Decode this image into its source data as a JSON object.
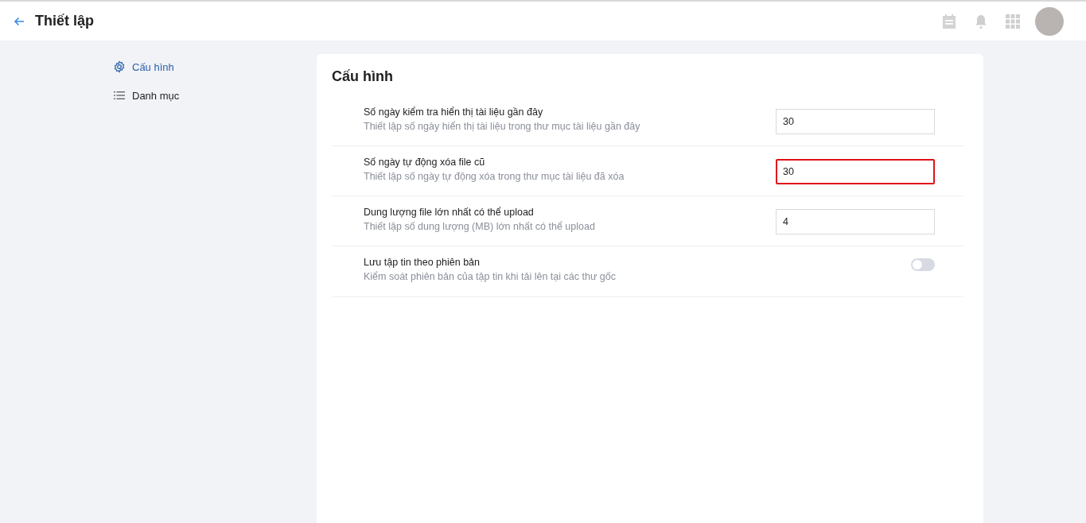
{
  "header": {
    "title": "Thiết lập"
  },
  "sidebar": {
    "items": [
      {
        "label": "Cấu hình",
        "kind": "gear",
        "selected": true
      },
      {
        "label": "Danh mục",
        "kind": "list",
        "selected": false
      }
    ]
  },
  "panel": {
    "title": "Cấu hình",
    "settings": [
      {
        "kind": "input",
        "title": "Số ngày kiểm tra hiển thị tài liệu gần đây",
        "description": "Thiết lập số ngày hiển thị tài liệu trong thư mục tài liệu gần đây",
        "value": "30",
        "highlighted": false
      },
      {
        "kind": "input",
        "title": "Số ngày tự động xóa file cũ",
        "description": "Thiết lập số ngày tự động xóa trong thư mục tài liệu đã xóa",
        "value": "30",
        "highlighted": true
      },
      {
        "kind": "input",
        "title": "Dung lượng file lớn nhất có thể upload",
        "description": "Thiết lập số dung lượng (MB) lớn nhất có thể upload",
        "value": "4",
        "highlighted": false
      },
      {
        "kind": "toggle",
        "title": "Lưu tập tin theo phiên bản",
        "description": "Kiểm soát phiên bản của tập tin khi tải lên tại các thư gốc",
        "on": false
      }
    ]
  }
}
